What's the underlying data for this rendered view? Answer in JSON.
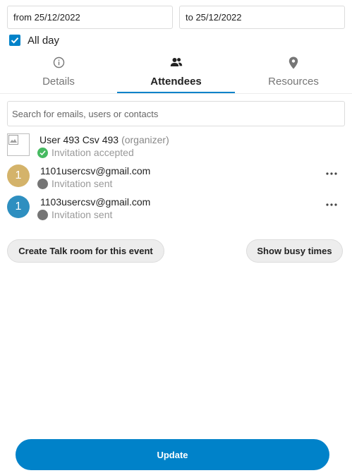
{
  "dates": {
    "from": "from 25/12/2022",
    "to": "to 25/12/2022"
  },
  "all_day": {
    "label": "All day",
    "checked": true
  },
  "tabs": [
    {
      "label": "Details",
      "icon": "info-icon",
      "active": false
    },
    {
      "label": "Attendees",
      "icon": "people-icon",
      "active": true
    },
    {
      "label": "Resources",
      "icon": "location-pin-icon",
      "active": false
    }
  ],
  "search": {
    "placeholder": "Search for emails, users or contacts"
  },
  "attendees": [
    {
      "name": "User 493 Csv 493",
      "role": "(organizer)",
      "status": "Invitation accepted",
      "status_color": "#46ba61",
      "avatar": "broken-image"
    },
    {
      "name": "1101usercsv@gmail.com",
      "status": "Invitation sent",
      "status_color": "#757575",
      "avatar_initial": "1",
      "avatar_color": "#d4b36a"
    },
    {
      "name": "1103usercsv@gmail.com",
      "status": "Invitation sent",
      "status_color": "#757575",
      "avatar_initial": "1",
      "avatar_color": "#2e8fc0"
    }
  ],
  "actions": {
    "talk_room": "Create Talk room for this event",
    "busy_times": "Show busy times",
    "update": "Update"
  },
  "colors": {
    "primary": "#0082c9",
    "accepted": "#46ba61",
    "pending": "#757575"
  }
}
